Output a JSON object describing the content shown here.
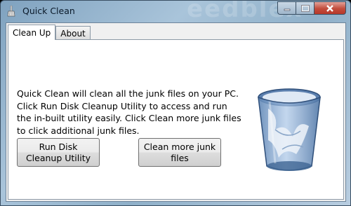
{
  "window": {
    "title": "Quick Clean",
    "watermark": "eedblex",
    "icons": {
      "app": "broom-icon",
      "minimize": "minimize-icon",
      "maximize": "maximize-icon",
      "close": "close-icon"
    }
  },
  "tabs": [
    {
      "label": "Clean Up",
      "active": true
    },
    {
      "label": "About",
      "active": false
    }
  ],
  "main": {
    "description": "Quick Clean will clean all the junk files on your PC. Click Run Disk Cleanup Utility to access and run the in-built utility easily. Click Clean more junk files to click additional junk files.",
    "run_button_label": "Run Disk Cleanup Utility",
    "clean_button_label": "Clean more junk files",
    "image": "recycle-bin-full-icon"
  },
  "colors": {
    "close": "#c24c3c",
    "frame": "#8fb0c9"
  }
}
